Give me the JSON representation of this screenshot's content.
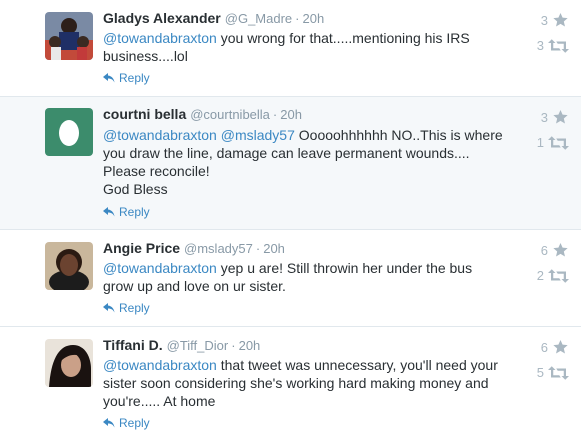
{
  "tweets": [
    {
      "fullname": "Gladys Alexander",
      "username": "@G_Madre",
      "time": "20h",
      "mention": "@towandabraxton",
      "text": " you wrong for that.....mentioning his IRS business....lol",
      "reply_label": "Reply",
      "favorites": "3",
      "retweets": "3"
    },
    {
      "fullname": "courtni bella",
      "username": "@courtnibella",
      "time": "20h",
      "mention": "@towandabraxton",
      "mention2": "@mslady57",
      "text": " Ooooohhhhhh NO..This is where you draw the line, damage can leave permanent wounds.... Please reconcile!",
      "text2": "God Bless",
      "reply_label": "Reply",
      "favorites": "3",
      "retweets": "1"
    },
    {
      "fullname": "Angie Price",
      "username": "@mslady57",
      "time": "20h",
      "mention": "@towandabraxton",
      "text": "  yep u are! Still throwin her under the bus grow up and love on ur sister.",
      "reply_label": "Reply",
      "favorites": "6",
      "retweets": "2"
    },
    {
      "fullname": "Tiffani D.",
      "username": "@Tiff_Dior",
      "time": "20h",
      "mention": "@towandabraxton",
      "text": " that tweet was unnecessary, you'll need your sister soon considering she's working hard making money and you're..... At home",
      "reply_label": "Reply",
      "favorites": "6",
      "retweets": "5"
    }
  ],
  "icons": {
    "reply": "reply-arrow-icon",
    "favorite": "star-icon",
    "retweet": "retweet-icon"
  },
  "colors": {
    "link": "#3b88c3",
    "muted": "#8899a6",
    "icon": "#aab8c2",
    "highlight_bg": "#f5f8fa",
    "egg_bg": "#3c8c6c"
  }
}
